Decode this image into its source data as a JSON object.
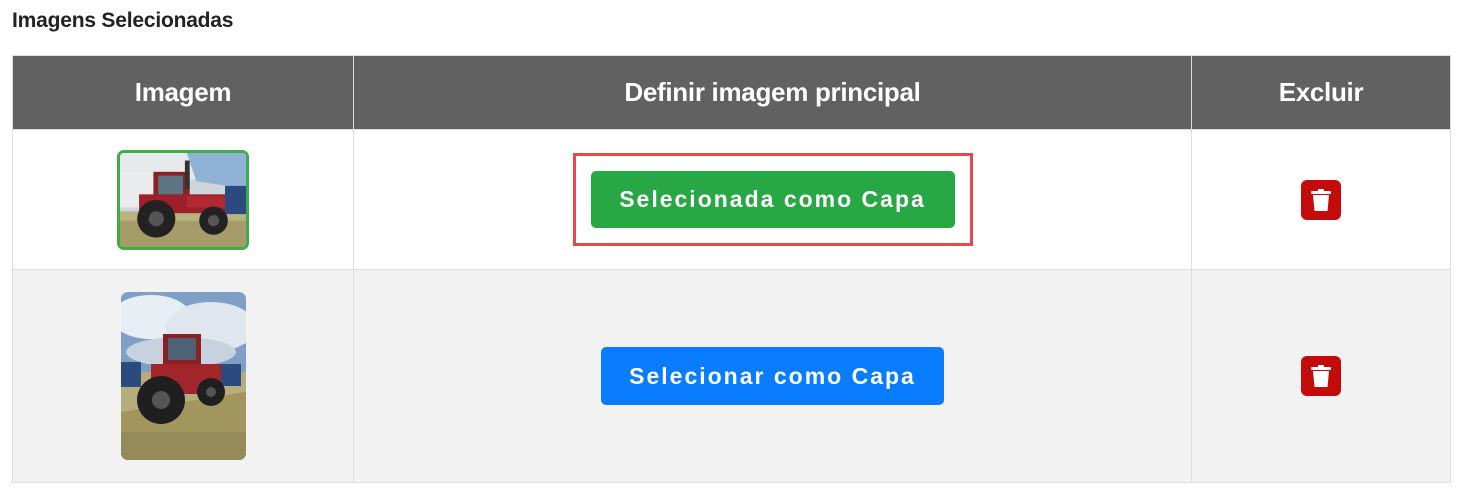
{
  "section": {
    "title": "Imagens Selecionadas"
  },
  "table": {
    "headers": [
      "Imagem",
      "Definir imagem principal",
      "Excluir"
    ],
    "rows": [
      {
        "thumbnail_icon": "red-tractor-photo",
        "is_cover": true,
        "cover_button_label": "Selecionada como Capa",
        "delete_icon": "trash-icon"
      },
      {
        "thumbnail_icon": "red-tractor-photo",
        "is_cover": false,
        "cover_button_label": "Selecionar como Capa",
        "delete_icon": "trash-icon"
      }
    ]
  },
  "colors": {
    "header_bg": "#616161",
    "selected_button": "#28a745",
    "select_button": "#0a7cff",
    "delete_button": "#c40b0b",
    "highlight_outline": "#e5484d",
    "selected_thumb_border": "#3cae48"
  }
}
